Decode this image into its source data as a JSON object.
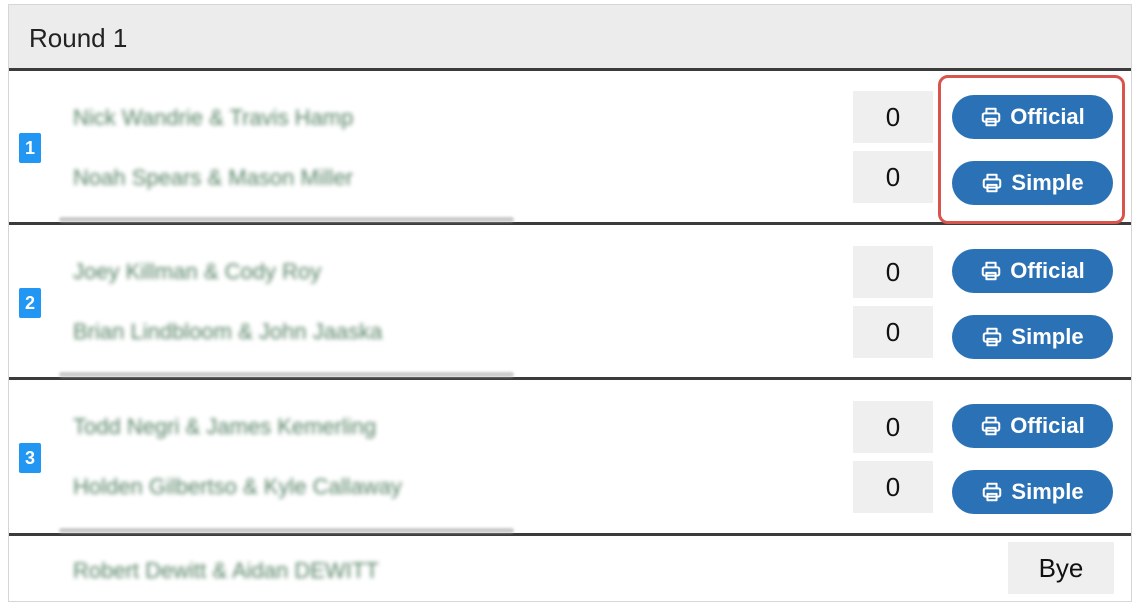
{
  "round": {
    "title": "Round 1"
  },
  "matches": [
    {
      "number": "1",
      "team1": "Nick Wandrie & Travis Hamp",
      "team2": "Noah Spears & Mason Miller",
      "score1": "0",
      "score2": "0",
      "official_label": "Official",
      "simple_label": "Simple"
    },
    {
      "number": "2",
      "team1": "Joey Killman & Cody Roy",
      "team2": "Brian Lindbloom & John Jaaska",
      "score1": "0",
      "score2": "0",
      "official_label": "Official",
      "simple_label": "Simple"
    },
    {
      "number": "3",
      "team1": "Todd Negri & James Kemerling",
      "team2": "Holden Gilbertso & Kyle Callaway",
      "score1": "0",
      "score2": "0",
      "official_label": "Official",
      "simple_label": "Simple"
    }
  ],
  "bye": {
    "team": "Robert Dewitt & Aidan DEWITT",
    "label": "Bye"
  },
  "colors": {
    "button": "#2b71b6",
    "match_badge": "#2196f3",
    "highlight": "#d9544d"
  },
  "icons": {
    "print": "printer-icon"
  }
}
